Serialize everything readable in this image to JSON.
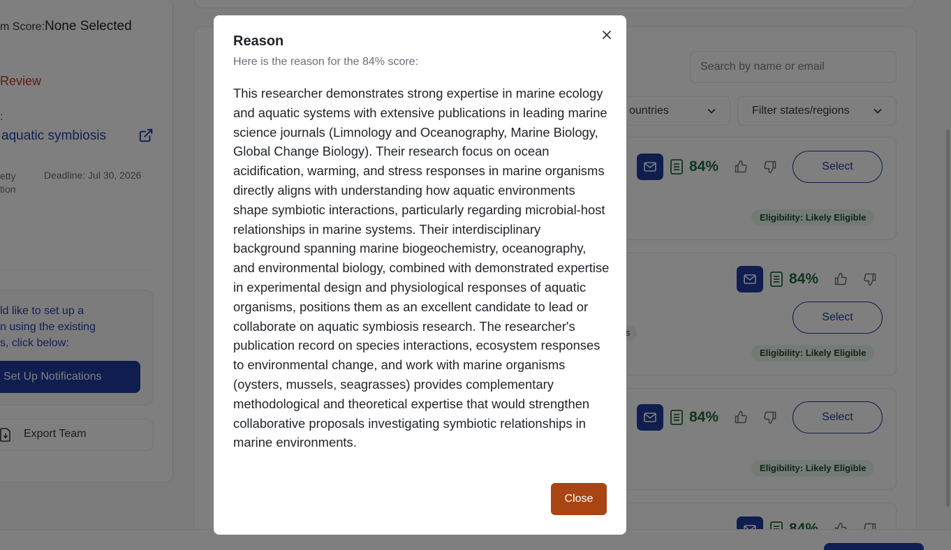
{
  "sidebar": {
    "team_score_label": "m Score:",
    "team_score_value": "None Selected",
    "review_label": "Review",
    "colon": ":",
    "opportunity_link": "aquatic symbiosis",
    "meta_line1": "etty",
    "meta_line2": "tion",
    "deadline": "Deadline: Jul 30, 2026",
    "notification_line1": "ld like to set up a",
    "notification_line2": "n using the existing",
    "notification_line3": "s, click below:",
    "setup_button": "Set Up Notifications",
    "export_button": "Export Team"
  },
  "main": {
    "search_placeholder": "Search by name or email",
    "filter_countries": "ountries",
    "filter_states": "Filter states/regions",
    "cards": [
      {
        "score": "84%",
        "select_label": "Select",
        "eligibility": "Eligibility: Likely Eligible"
      },
      {
        "score": "84%",
        "select_label": "Select",
        "eligibility": "Eligibility: Likely Eligible",
        "tag": "ces"
      },
      {
        "score": "84%",
        "select_label": "Select",
        "eligibility": "Eligibility: Likely Eligible"
      },
      {
        "score": "84%"
      }
    ]
  },
  "modal": {
    "title": "Reason",
    "subtitle": "Here is the reason for the 84% score:",
    "body": "This researcher demonstrates strong expertise in marine ecology and aquatic systems with extensive publications in leading marine science journals (Limnology and Oceanography, Marine Biology, Global Change Biology). Their research focus on ocean acidification, warming, and stress responses in marine organisms directly aligns with understanding how aquatic environments shape symbiotic interactions, particularly regarding microbial-host relationships in marine systems. Their interdisciplinary background spanning marine biogeochemistry, oceanography, and environmental biology, combined with demonstrated expertise in experimental design and physiological responses of aquatic organisms, positions them as an excellent candidate to lead or collaborate on aquatic symbiosis research. The researcher's publication record on species interactions, ecosystem responses to environmental change, and work with marine organisms (oysters, mussels, seagrasses) provides complementary methodological and theoretical expertise that would strengthen collaborative proposals investigating symbiotic relationships in marine environments.",
    "close_label": "Close"
  },
  "colors": {
    "primary": "#1f3c9e",
    "close_button": "#a84512",
    "score_green": "#1f6b3a",
    "review_red": "#c0392b"
  },
  "icons": [
    "external-link-icon",
    "export-file-icon",
    "chevron-down-icon",
    "mail-icon",
    "document-icon",
    "thumbs-up-icon",
    "thumbs-down-icon",
    "close-icon"
  ]
}
